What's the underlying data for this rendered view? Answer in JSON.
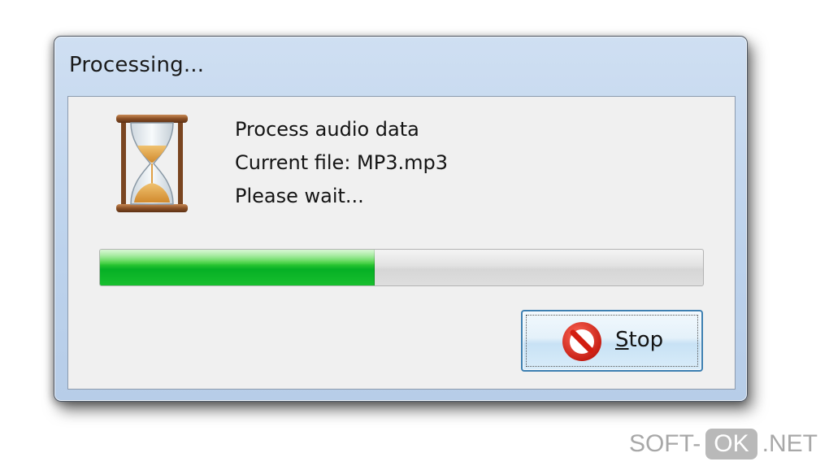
{
  "window": {
    "title": "Processing..."
  },
  "message": {
    "line1": "Process audio data",
    "line2": "Current file: MP3.mp3",
    "line3": "Please wait..."
  },
  "progress": {
    "fraction": 0.455,
    "fill_color": "#06b025"
  },
  "stop_button": {
    "accelerator": "S",
    "label_rest": "top",
    "icon": "stop-sign-icon"
  },
  "status_icon": "hourglass-icon",
  "watermark": {
    "left": "SOFT-",
    "box": "OK",
    "right": ".NET"
  }
}
